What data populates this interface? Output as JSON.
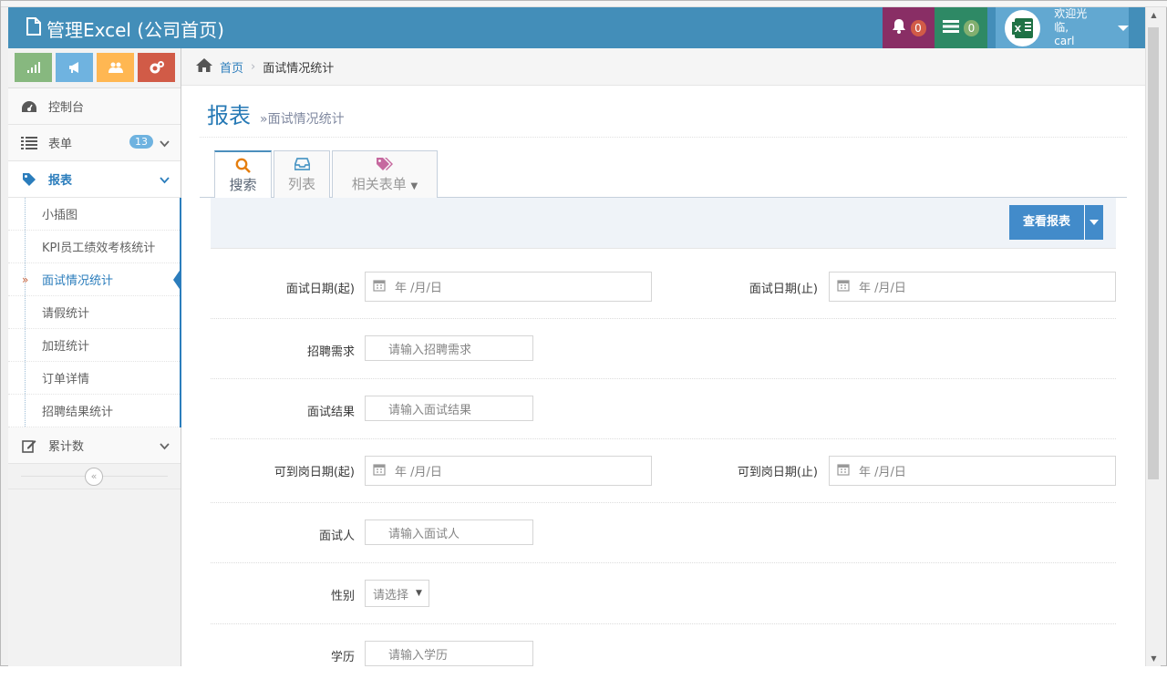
{
  "navbar": {
    "title": "管理Excel (公司首页)",
    "notifications_count": "0",
    "messages_count": "0",
    "welcome_text": "欢迎光临,",
    "username": "carl"
  },
  "sidebar": {
    "shortcut_colors": [
      "#87b87f",
      "#6fb3e0",
      "#ffb752",
      "#d15b47"
    ],
    "items": [
      {
        "label": "控制台",
        "icon": "dashboard-icon"
      },
      {
        "label": "表单",
        "icon": "list-icon",
        "badge": "13"
      },
      {
        "label": "报表",
        "icon": "tag-icon"
      },
      {
        "label": "累计数",
        "icon": "edit-icon"
      }
    ],
    "submenu": [
      "小插图",
      "KPI员工绩效考核统计",
      "面试情况统计",
      "请假统计",
      "加班统计",
      "订单详情",
      "招聘结果统计"
    ],
    "collapse_glyph": "«"
  },
  "breadcrumb": {
    "home": "首页",
    "separator": "›",
    "current": "面试情况统计"
  },
  "page": {
    "title": "报表",
    "subtitle": "»面试情况统计"
  },
  "tabs": [
    {
      "label": "搜索",
      "icon": "search-icon"
    },
    {
      "label": "列表",
      "icon": "inbox-icon"
    },
    {
      "label": "相关表单",
      "icon": "tags-icon"
    }
  ],
  "toolbar": {
    "view_report": "查看报表"
  },
  "form": {
    "interview_date_from_label": "面试日期(起)",
    "interview_date_to_label": "面试日期(止)",
    "date_placeholder": "年 /月/日",
    "recruit_need_label": "招聘需求",
    "recruit_need_placeholder": "请输入招聘需求",
    "interview_result_label": "面试结果",
    "interview_result_placeholder": "请输入面试结果",
    "available_date_from_label": "可到岗日期(起)",
    "available_date_to_label": "可到岗日期(止)",
    "interviewer_label": "面试人",
    "interviewer_placeholder": "请输入面试人",
    "gender_label": "性别",
    "gender_selected": "请选择",
    "education_label": "学历",
    "education_placeholder": "请输入学历"
  }
}
